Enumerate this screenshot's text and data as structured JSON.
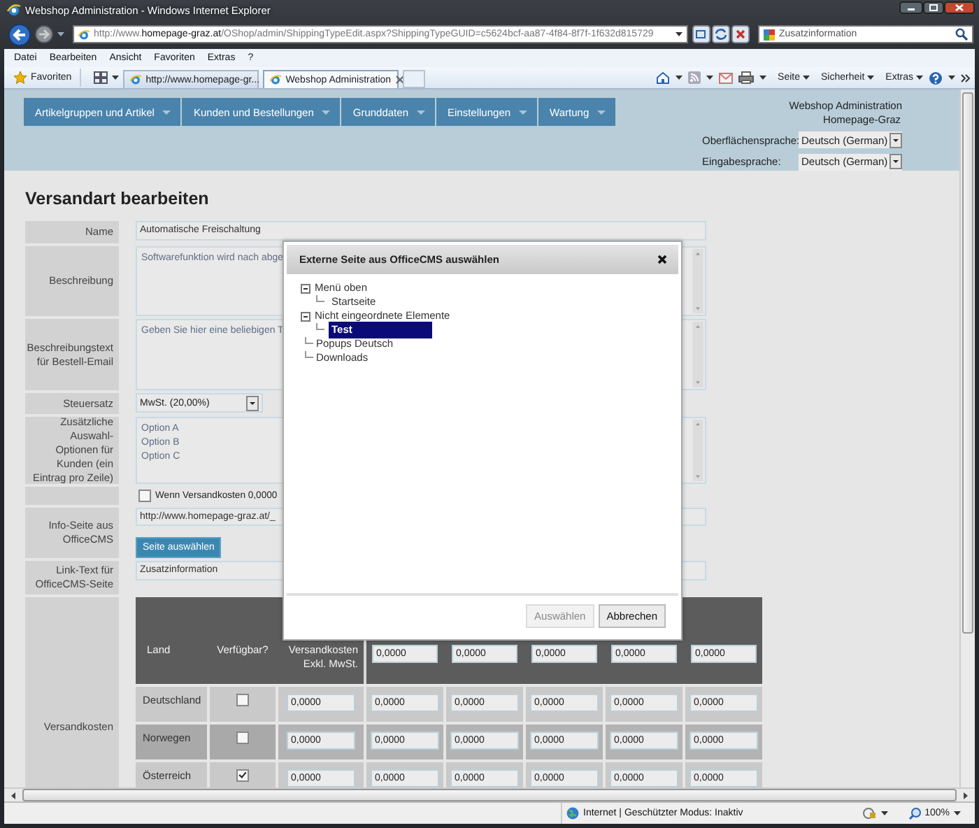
{
  "window": {
    "title": "Webshop Administration - Windows Internet Explorer"
  },
  "address_bar": {
    "url": "http://www.**homepage-graz.at**/OShop/admin/ShippingTypeEdit.aspx?ShippingTypeGUID=c5624bcf-aa87-4f84-8f7f-1f632d815729"
  },
  "search": {
    "value": "Zusatzinformation"
  },
  "menu_bar": [
    "Datei",
    "Bearbeiten",
    "Ansicht",
    "Favoriten",
    "Extras",
    "?"
  ],
  "favorites": "Favoriten",
  "tabs": [
    {
      "label": "http://www.homepage-gr...",
      "selected": false
    },
    {
      "label": "Webshop Administration",
      "selected": true
    }
  ],
  "command_bar": [
    "Seite",
    "Sicherheit",
    "Extras"
  ],
  "nav": [
    "Artikelgruppen und Artikel",
    "Kunden und Bestellungen",
    "Grunddaten",
    "Einstellungen",
    "Wartung"
  ],
  "header": {
    "app": "Webshop Administration",
    "site": "Homepage-Graz",
    "languages": [
      {
        "label": "Oberflächensprache:",
        "value": "Deutsch (German)"
      },
      {
        "label": "Eingabesprache:",
        "value": "Deutsch (German)"
      }
    ]
  },
  "page_title": "Versandart bearbeiten",
  "form": [
    {
      "kind": "text",
      "label": "Name",
      "value": "Automatische Freischaltung"
    },
    {
      "kind": "textarea",
      "label": "Beschreibung",
      "lines": [
        "Softwarefunktion wird nach abge"
      ]
    },
    {
      "kind": "textarea",
      "label": "Beschreibungstext für Bestell-Email",
      "lines": [
        "Geben Sie hier eine beliebigen T"
      ]
    },
    {
      "kind": "select",
      "label": "Steuersatz",
      "value": "MwSt. (20,00%)"
    },
    {
      "kind": "textarea",
      "label": "Zusätzliche Auswahl-Optionen für Kunden (ein Eintrag pro Zeile)",
      "lines": [
        "Option A",
        "Option B",
        "Option C"
      ]
    },
    {
      "kind": "checkbox",
      "checked": false,
      "text": "Wenn Versandkosten 0,0000"
    },
    {
      "kind": "page_link",
      "label": "Info-Seite aus OfficeCMS",
      "value": "http://www.homepage-graz.at/_",
      "button": "Seite auswählen"
    },
    {
      "kind": "text",
      "label": "Link-Text für OfficeCMS-Seite",
      "value": "Zusatzinformation"
    },
    {
      "kind": "costs",
      "label": "Versandkosten"
    }
  ],
  "costs": {
    "columns": [
      "Land",
      "Verfügbar?",
      "Versandkosten Exkl. MwSt."
    ],
    "header_values": [
      "0,0000",
      "0,0000",
      "0,0000",
      "0,0000",
      "0,0000"
    ],
    "rows": [
      {
        "country": "Deutschland",
        "available": false,
        "values": [
          "0,0000",
          "0,0000",
          "0,0000",
          "0,0000",
          "0,0000",
          "0,0000"
        ]
      },
      {
        "country": "Norwegen",
        "available": false,
        "values": [
          "0,0000",
          "0,0000",
          "0,0000",
          "0,0000",
          "0,0000",
          "0,0000"
        ]
      },
      {
        "country": "Österreich",
        "available": true,
        "values": [
          "0,0000",
          "0,0000",
          "0,0000",
          "0,0000",
          "0,0000",
          "0,0000"
        ]
      }
    ]
  },
  "dialog": {
    "title": "Externe Seite aus OfficeCMS auswählen",
    "tree": [
      {
        "label": "Menü oben",
        "selected": false,
        "expanded": true,
        "children": [
          {
            "label": "Startseite",
            "selected": false
          }
        ]
      },
      {
        "label": "Nicht eingeordnete Elemente",
        "selected": false,
        "expanded": true,
        "children": [
          {
            "label": "Test",
            "selected": true
          }
        ]
      },
      {
        "label": "Popups Deutsch",
        "selected": false
      },
      {
        "label": "Downloads",
        "selected": false
      }
    ],
    "buttons": [
      {
        "label": "Auswählen",
        "disabled": true
      },
      {
        "label": "Abbrechen",
        "disabled": false
      }
    ]
  },
  "status_bar": {
    "text": "Internet | Geschützter Modus: Inaktiv",
    "zoom": "100%"
  }
}
